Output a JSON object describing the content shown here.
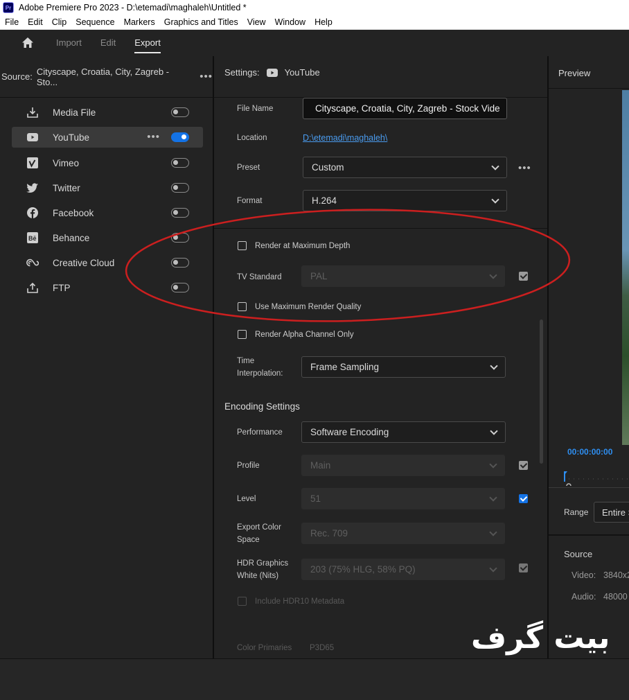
{
  "window": {
    "title": "Adobe Premiere Pro 2023 - D:\\etemadi\\maghaleh\\Untitled *",
    "app_icon": "Pr"
  },
  "menu": [
    "File",
    "Edit",
    "Clip",
    "Sequence",
    "Markers",
    "Graphics and Titles",
    "View",
    "Window",
    "Help"
  ],
  "nav": {
    "tabs": [
      "Import",
      "Edit",
      "Export"
    ],
    "active": "Export"
  },
  "source": {
    "label": "Source:",
    "value": "Cityscape, Croatia, City, Zagreb - Sto..."
  },
  "destinations": [
    {
      "label": "Media File",
      "icon": "download-icon",
      "on": false
    },
    {
      "label": "YouTube",
      "icon": "youtube-icon",
      "on": true
    },
    {
      "label": "Vimeo",
      "icon": "vimeo-icon",
      "on": false
    },
    {
      "label": "Twitter",
      "icon": "twitter-icon",
      "on": false
    },
    {
      "label": "Facebook",
      "icon": "facebook-icon",
      "on": false
    },
    {
      "label": "Behance",
      "icon": "behance-icon",
      "on": false
    },
    {
      "label": "Creative Cloud",
      "icon": "creative-cloud-icon",
      "on": false
    },
    {
      "label": "FTP",
      "icon": "upload-icon",
      "on": false
    }
  ],
  "settings": {
    "header_label": "Settings:",
    "header_value": "YouTube",
    "file_name_label": "File Name",
    "file_name_value": "Cityscape, Croatia, City, Zagreb - Stock Vide",
    "location_label": "Location",
    "location_value": "D:\\etemadi\\maghaleh\\",
    "preset_label": "Preset",
    "preset_value": "Custom",
    "format_label": "Format",
    "format_value": "H.264",
    "render_max_depth": "Render at Maximum Depth",
    "tv_standard_label": "TV Standard",
    "tv_standard_value": "PAL",
    "use_max_quality": "Use Maximum Render Quality",
    "render_alpha": "Render Alpha Channel Only",
    "time_interp_label_1": "Time",
    "time_interp_label_2": "Interpolation:",
    "time_interp_value": "Frame Sampling"
  },
  "encoding": {
    "header": "Encoding Settings",
    "performance_label": "Performance",
    "performance_value": "Software Encoding",
    "profile_label": "Profile",
    "profile_value": "Main",
    "level_label": "Level",
    "level_value": "51",
    "color_space_label_1": "Export Color",
    "color_space_label_2": "Space",
    "color_space_value": "Rec. 709",
    "hdr_label_1": "HDR Graphics",
    "hdr_label_2": "White (Nits)",
    "hdr_value": "203 (75% HLG, 58% PQ)",
    "hdr10_meta": "Include HDR10 Metadata",
    "color_primaries_label": "Color Primaries",
    "color_primaries_value": "P3D65"
  },
  "preview": {
    "title": "Preview",
    "timecode": "00:00:00:00",
    "range_label": "Range",
    "range_value": "Entire S",
    "source_header": "Source",
    "video_label": "Video:",
    "video_value": "3840x2",
    "audio_label": "Audio:",
    "audio_value": "48000"
  },
  "watermark": "بیت گرف",
  "colors": {
    "accent": "#1473e6",
    "annotation": "#cc1f1f",
    "link": "#4a9cf0"
  }
}
